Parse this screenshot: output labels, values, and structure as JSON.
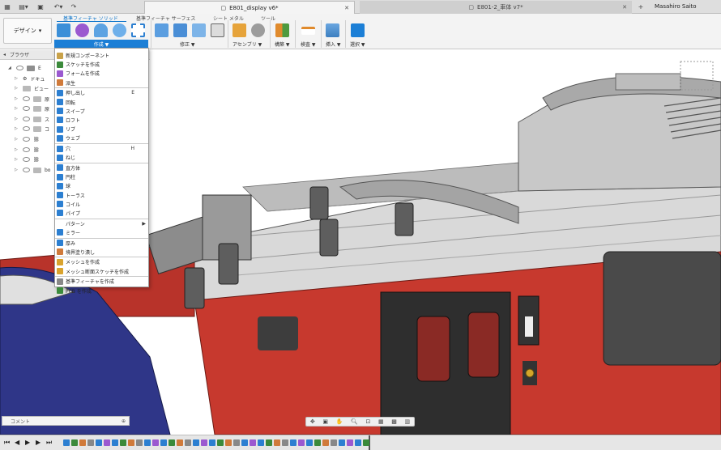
{
  "title_bar": {
    "active_tab": "E801_display v6*",
    "inactive_tab": "E801-2_車体 v7*",
    "user": "Masahiro Saito",
    "new_tab": "+"
  },
  "ribbon": {
    "workspace": "デザイン",
    "tabs": [
      "基準フィーチャ ソリッド",
      "基準フィーチャ サーフェス",
      "シート メタル",
      "ツール"
    ],
    "groups": {
      "create": "作成 ▼",
      "modify": "修正 ▼",
      "assemble": "アセンブリ ▼",
      "construct": "構築 ▼",
      "inspect": "検査 ▼",
      "insert": "挿入 ▼",
      "select": "選択 ▼"
    }
  },
  "browser": {
    "header": "ブラウザ",
    "items": [
      "E",
      "ドキュ",
      "ビュー",
      "原",
      "原",
      "ス",
      "コ",
      "",
      "",
      "",
      "bo"
    ]
  },
  "create_menu": {
    "items": [
      {
        "label": "新規コンポーネント",
        "shortcut": "",
        "color": "#c9a24a"
      },
      {
        "label": "スケッチを作成",
        "shortcut": "",
        "color": "#3b8a3b"
      },
      {
        "label": "フォームを作成",
        "shortcut": "",
        "color": "#9b59d0"
      },
      {
        "label": "派生",
        "shortcut": "",
        "color": "#d07a3a"
      },
      {
        "label": "押し出し",
        "shortcut": "E",
        "color": "#2c7fd1"
      },
      {
        "label": "回転",
        "shortcut": "",
        "color": "#2c7fd1"
      },
      {
        "label": "スイープ",
        "shortcut": "",
        "color": "#2c7fd1"
      },
      {
        "label": "ロフト",
        "shortcut": "",
        "color": "#2c7fd1"
      },
      {
        "label": "リブ",
        "shortcut": "",
        "color": "#2c7fd1"
      },
      {
        "label": "ウェブ",
        "shortcut": "",
        "color": "#2c7fd1"
      },
      {
        "label": "穴",
        "shortcut": "H",
        "color": "#2c7fd1"
      },
      {
        "label": "ねじ",
        "shortcut": "",
        "color": "#2c7fd1"
      },
      {
        "label": "直方体",
        "shortcut": "",
        "color": "#2c7fd1"
      },
      {
        "label": "円柱",
        "shortcut": "",
        "color": "#2c7fd1"
      },
      {
        "label": "球",
        "shortcut": "",
        "color": "#2c7fd1"
      },
      {
        "label": "トーラス",
        "shortcut": "",
        "color": "#2c7fd1"
      },
      {
        "label": "コイル",
        "shortcut": "",
        "color": "#2c7fd1"
      },
      {
        "label": "パイプ",
        "shortcut": "",
        "color": "#2c7fd1"
      },
      {
        "label": "パターン",
        "shortcut": "▶",
        "color": ""
      },
      {
        "label": "ミラー",
        "shortcut": "",
        "color": "#2c7fd1"
      },
      {
        "label": "厚み",
        "shortcut": "",
        "color": "#2c7fd1"
      },
      {
        "label": "境界塗り潰し",
        "shortcut": "",
        "color": "#d07a3a"
      },
      {
        "label": "メッシュを作成",
        "shortcut": "",
        "color": "#d9a32e"
      },
      {
        "label": "メッシュ断面スケッチを作成",
        "shortcut": "",
        "color": "#d9a32e"
      },
      {
        "label": "基準フィーチャを作成",
        "shortcut": "",
        "color": "#888888"
      },
      {
        "label": "PCB を作成",
        "shortcut": "",
        "color": "#3b8a3b"
      }
    ]
  },
  "comment_panel": {
    "label": "コメント"
  },
  "colors": {
    "accent": "#1c7fd6",
    "car_red": "#c7392e",
    "car_blue": "#2f3688"
  }
}
